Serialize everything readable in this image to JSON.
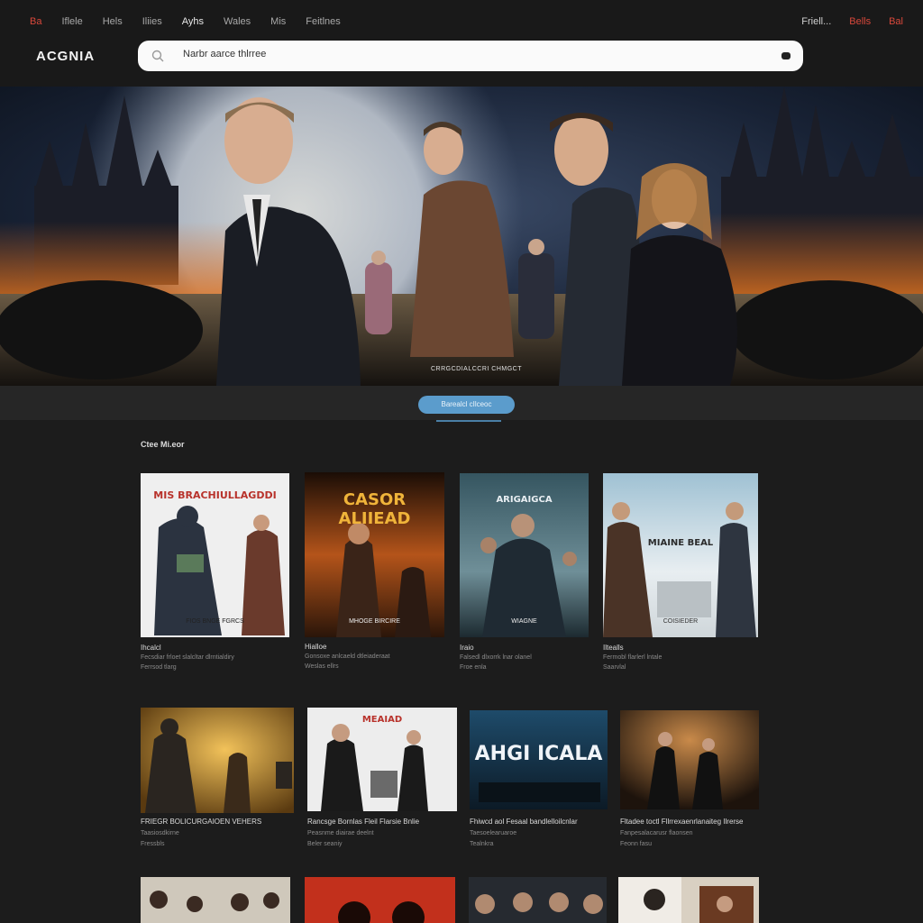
{
  "nav": {
    "links": [
      "Ba",
      "Iflele",
      "Hels",
      "Iliies",
      "Ayhs",
      "Wales",
      "Mis",
      "Feitlnes"
    ],
    "right": [
      "Friell...",
      "Bells",
      "Bal"
    ]
  },
  "app": {
    "logo": "ACGNIA"
  },
  "search": {
    "placeholder": "Narbr aarce thlrree"
  },
  "hero": {
    "caption": "CRRGCDIALCCRI CHMGCT",
    "button": "Barealcl cIlceoc"
  },
  "section": {
    "title": "Ctee Mi.eor"
  },
  "row1": [
    {
      "poster_title": "MIS  BRACHIULLAGDDI",
      "poster_foot": "FIOS  BNGE FGRCS",
      "title": "Ihcalcl",
      "line1": "Fecsdiar frloet slalcltar dlrntialdiry",
      "line2": "Ferrsod tlarg"
    },
    {
      "poster_title": "CASOR ALIIEAD",
      "poster_foot": "MHOGE BIRCIRE",
      "title": "Hialloe",
      "line1": "Gonsoxe anlcaeld dtleiaderaat",
      "line2": "Weslas ellrs"
    },
    {
      "poster_title": "ARIGAIGCA",
      "poster_foot": "WIAGNE",
      "title": "Iraio",
      "line1": "Falsedl dlxorrk lnar olanel",
      "line2": "Froe enla"
    },
    {
      "poster_title": "MIAINE BEAL",
      "poster_foot": "COISIEDER",
      "title": "Iltealls",
      "line1": "Fermobl flarlerl lntale",
      "line2": "Saarvlal"
    }
  ],
  "row2": [
    {
      "poster_title": "",
      "title": "FRIEGR BOLICURGAIOEN VEHERS",
      "line1": "Taasiosdkirne",
      "line2": "Fressbls"
    },
    {
      "poster_title": "MEAIAD",
      "title": "Rancsge  Bornlas  Fleil Flarsie  Bnlie",
      "line1": "Peasnme diairae deelnt",
      "line2": "Beler seaniy"
    },
    {
      "poster_title": "AHGI ICALA",
      "title": "Fhiwcd  aol  Fesaal bandlelloilcnlar",
      "line1": "Taesoelearuaroe",
      "line2": "Tealnkra"
    },
    {
      "poster_title": "",
      "title": "Fltadee  toctl  Fllrrexaenrlanaiteg  Ilrerse",
      "line1": "Fanpesalacarusr flaonsen",
      "line2": "Feonn fasu"
    }
  ],
  "colors": {
    "accent": "#5b9ccc",
    "active_nav": "#d9483b",
    "background": "#1c1c1c"
  }
}
